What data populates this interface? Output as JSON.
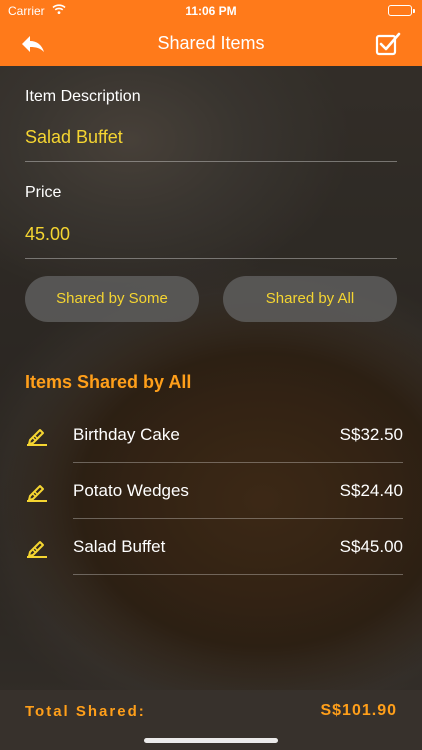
{
  "status_bar": {
    "carrier": "Carrier",
    "time": "11:06 PM"
  },
  "nav": {
    "title": "Shared Items",
    "back_icon": "back-arrow-icon",
    "done_icon": "checkbox-done-icon"
  },
  "form": {
    "description_label": "Item Description",
    "description_value": "Salad Buffet",
    "price_label": "Price",
    "price_value": "45.00"
  },
  "buttons": {
    "shared_by_some": "Shared by Some",
    "shared_by_all": "Shared by All"
  },
  "section": {
    "title": "Items Shared by All"
  },
  "items": [
    {
      "name": "Birthday Cake",
      "amount": "S$32.50"
    },
    {
      "name": "Potato Wedges",
      "amount": "S$24.40"
    },
    {
      "name": "Salad Buffet",
      "amount": "S$45.00"
    }
  ],
  "footer": {
    "label": "Total Shared:",
    "value": "S$101.90"
  },
  "colors": {
    "brand_orange": "#ff7a1a",
    "accent_yellow": "#f5d531",
    "total_orange": "#ff9f1a"
  }
}
